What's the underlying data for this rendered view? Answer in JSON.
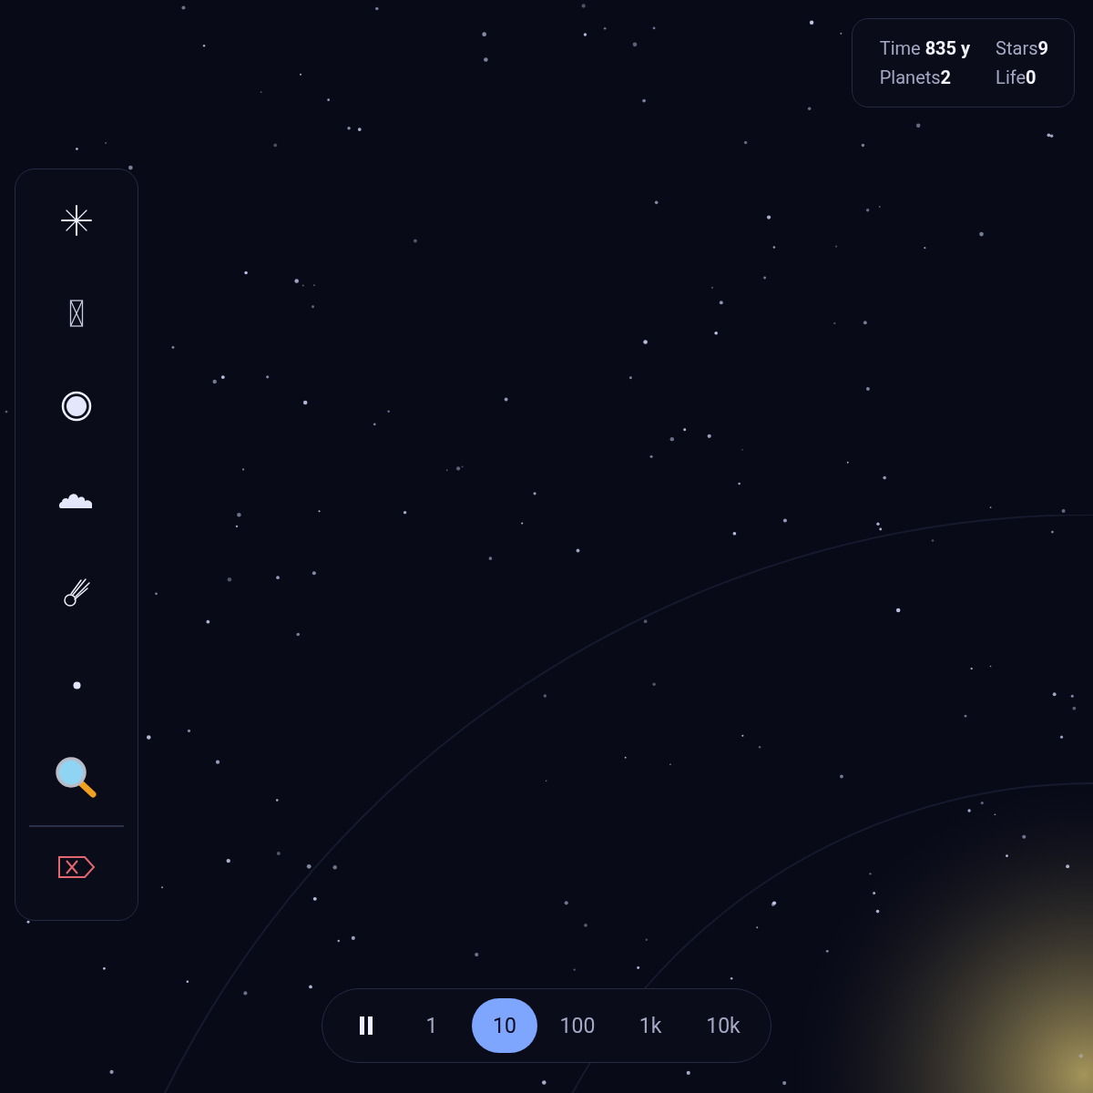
{
  "stats": [
    {
      "text": "Time **835 y**"
    },
    {
      "text": "Stars**9**"
    },
    {
      "text": "Planets**2**"
    },
    {
      "text": "Life**0**"
    }
  ],
  "tools": [
    {
      "kind": "star"
    },
    {
      "kind": "blackhole"
    },
    {
      "kind": "planet"
    },
    {
      "kind": "nebula"
    },
    {
      "kind": "comet"
    },
    {
      "kind": "dust"
    },
    {
      "kind": "inspect"
    },
    {
      "kind": "clear"
    }
  ],
  "speeds": [
    {
      "label": "1",
      "selected": false
    },
    {
      "label": "10",
      "selected": true
    },
    {
      "label": "100",
      "selected": false
    },
    {
      "label": "1k",
      "selected": false
    },
    {
      "label": "10k",
      "selected": false
    }
  ]
}
